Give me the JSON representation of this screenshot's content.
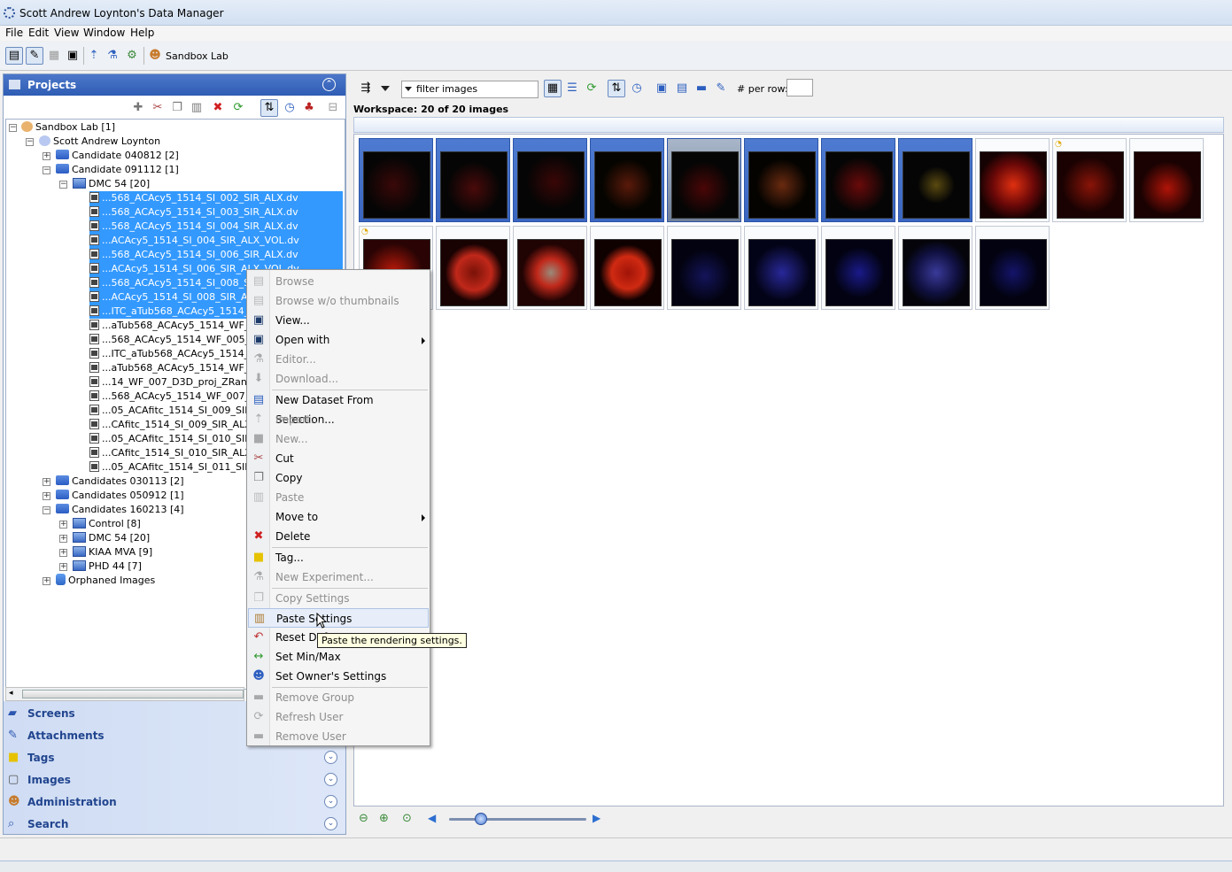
{
  "window": {
    "title": "Scott Andrew Loynton's Data Manager"
  },
  "menubar": [
    "File",
    "Edit",
    "View",
    "Window",
    "Help"
  ],
  "toolbar": {
    "group_label": "Sandbox Lab"
  },
  "projects_panel": {
    "title": "Projects"
  },
  "tree": {
    "root": "Sandbox Lab [1]",
    "user": "Scott Andrew Loynton",
    "items": [
      "Candidate 040812 [2]",
      "Candidate 091112 [1]",
      "DMC 54 [20]",
      "...568_ACAcy5_1514_SI_002_SIR_ALX.dv",
      "...568_ACAcy5_1514_SI_003_SIR_ALX.dv",
      "...568_ACAcy5_1514_SI_004_SIR_ALX.dv",
      "...ACAcy5_1514_SI_004_SIR_ALX_VOL.dv",
      "...568_ACAcy5_1514_SI_006_SIR_ALX.dv",
      "...ACAcy5_1514_SI_006_SIR_ALX_VOL.dv",
      "...568_ACAcy5_1514_SI_008_SIR_ALX.dv",
      "...ACAcy5_1514_SI_008_SIR_ALX_VOL.dv",
      "...ITC_aTub568_ACAcy5_1514_SI_010.dv",
      "...aTub568_ACAcy5_1514_WF_004.dv",
      "...568_ACAcy5_1514_WF_005_D3D.dv",
      "...ITC_aTub568_ACAcy5_1514_WF_006.dv",
      "...aTub568_ACAcy5_1514_WF_006_D3D.dv",
      "...14_WF_007_D3D_proj_ZRange.dv",
      "...568_ACAcy5_1514_WF_007_D3D.dv",
      "...05_ACAfitc_1514_SI_009_SIR.dv",
      "...CAfitc_1514_SI_009_SIR_ALX.dv",
      "...05_ACAfitc_1514_SI_010_SIR.dv",
      "...CAfitc_1514_SI_010_SIR_ALX.dv",
      "...05_ACAfitc_1514_SI_011_SIR.dv",
      "Candidates 030113 [2]",
      "Candidates 050912 [1]",
      "Candidates 160213 [4]",
      "Control [8]",
      "DMC 54 [20]",
      "KIAA MVA [9]",
      "PHD 44 [7]",
      "Orphaned Images"
    ]
  },
  "taskpanes": [
    "Screens",
    "Attachments",
    "Tags",
    "Images",
    "Administration",
    "Search"
  ],
  "workspace": {
    "filter_placeholder": "filter  images",
    "per_row_label": "# per row:",
    "label": "Workspace: 20 of 20 images",
    "thumb_count_selected": 8,
    "thumb_count": 20
  },
  "context_menu": {
    "items": [
      {
        "label": "Browse",
        "enabled": false,
        "icon": "browse-icon"
      },
      {
        "label": "Browse w/o thumbnails",
        "enabled": false,
        "icon": "browse-icon"
      },
      {
        "label": "View...",
        "enabled": true,
        "icon": "monitor-icon"
      },
      {
        "label": "Open with",
        "enabled": true,
        "icon": "monitor-icon",
        "submenu": true
      },
      {
        "label": "Editor...",
        "enabled": false,
        "icon": "editor-icon"
      },
      {
        "label": "Download...",
        "enabled": false,
        "icon": "download-icon"
      },
      {
        "label": "New Dataset From Selection...",
        "enabled": true,
        "icon": "dataset-icon"
      },
      {
        "label": "Import...",
        "enabled": false,
        "icon": "import-icon"
      },
      {
        "label": "New...",
        "enabled": false,
        "icon": "new-icon"
      },
      {
        "label": "Cut",
        "enabled": true,
        "icon": "scissors-icon"
      },
      {
        "label": "Copy",
        "enabled": true,
        "icon": "copy-icon"
      },
      {
        "label": "Paste",
        "enabled": false,
        "icon": "paste-icon"
      },
      {
        "label": "Move to",
        "enabled": true,
        "icon": "",
        "submenu": true
      },
      {
        "label": "Delete",
        "enabled": true,
        "icon": "delete-icon"
      },
      {
        "label": "Tag...",
        "enabled": true,
        "icon": "tag-icon"
      },
      {
        "label": "New Experiment...",
        "enabled": false,
        "icon": "experiment-icon"
      },
      {
        "label": "Copy Settings",
        "enabled": false,
        "icon": "copy-settings-icon"
      },
      {
        "label": "Paste Settings",
        "enabled": true,
        "icon": "paste-settings-icon"
      },
      {
        "label": "Reset Defaults",
        "enabled": true,
        "icon": "reset-icon"
      },
      {
        "label": "Set Min/Max",
        "enabled": true,
        "icon": "minmax-icon"
      },
      {
        "label": "Set Owner's Settings",
        "enabled": true,
        "icon": "owner-settings-icon"
      },
      {
        "label": "Remove Group",
        "enabled": false,
        "icon": "remove-icon"
      },
      {
        "label": "Refresh User",
        "enabled": false,
        "icon": "refresh-icon"
      },
      {
        "label": "Remove User",
        "enabled": false,
        "icon": "remove-icon"
      }
    ],
    "reset_visible": "Reset Def"
  },
  "tooltip": "Paste the rendering settings.",
  "colors": {
    "selection": "#3399ff",
    "panel_header": "#2e5db4",
    "pane_text": "#21458f"
  }
}
